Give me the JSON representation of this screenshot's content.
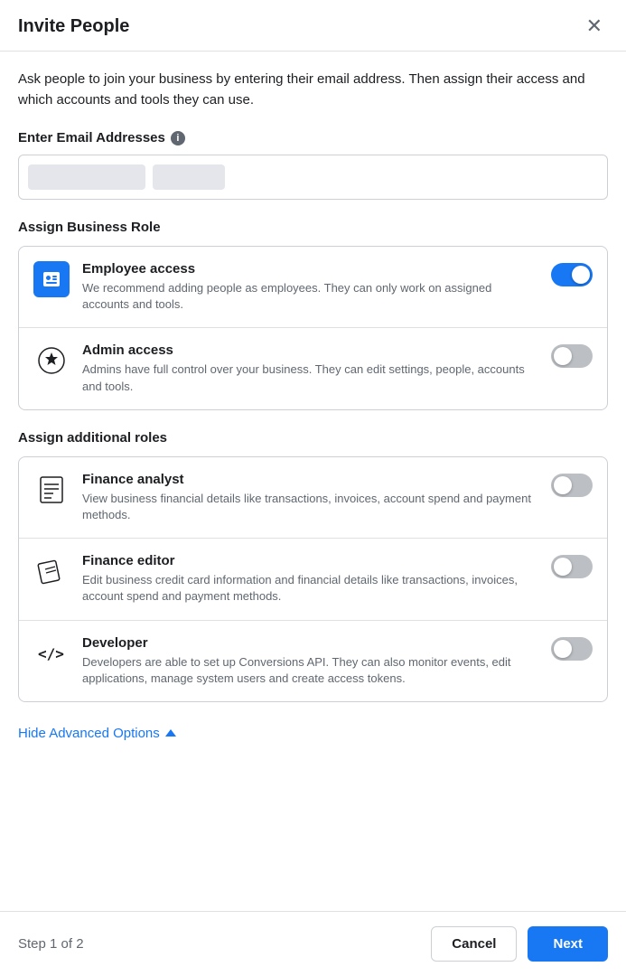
{
  "modal": {
    "title": "Invite People",
    "close_label": "×",
    "intro_text": "Ask people to join your business by entering their email address. Then assign their access and which accounts and tools they can use.",
    "email_section": {
      "label": "Enter Email Addresses",
      "has_info": true
    },
    "business_role_section": {
      "title": "Assign Business Role",
      "roles": [
        {
          "id": "employee",
          "name": "Employee access",
          "description": "We recommend adding people as employees. They can only work on assigned accounts and tools.",
          "enabled": true
        },
        {
          "id": "admin",
          "name": "Admin access",
          "description": "Admins have full control over your business. They can edit settings, people, accounts and tools.",
          "enabled": false
        }
      ]
    },
    "additional_roles_section": {
      "title": "Assign additional roles",
      "roles": [
        {
          "id": "finance_analyst",
          "name": "Finance analyst",
          "description": "View business financial details like transactions, invoices, account spend and payment methods.",
          "enabled": false
        },
        {
          "id": "finance_editor",
          "name": "Finance editor",
          "description": "Edit business credit card information and financial details like transactions, invoices, account spend and payment methods.",
          "enabled": false
        },
        {
          "id": "developer",
          "name": "Developer",
          "description": "Developers are able to set up Conversions API. They can also monitor events, edit applications, manage system users and create access tokens.",
          "enabled": false
        }
      ]
    },
    "advanced_options_label": "Hide Advanced Options",
    "footer": {
      "step_label": "Step 1 of 2",
      "cancel_label": "Cancel",
      "next_label": "Next"
    }
  }
}
